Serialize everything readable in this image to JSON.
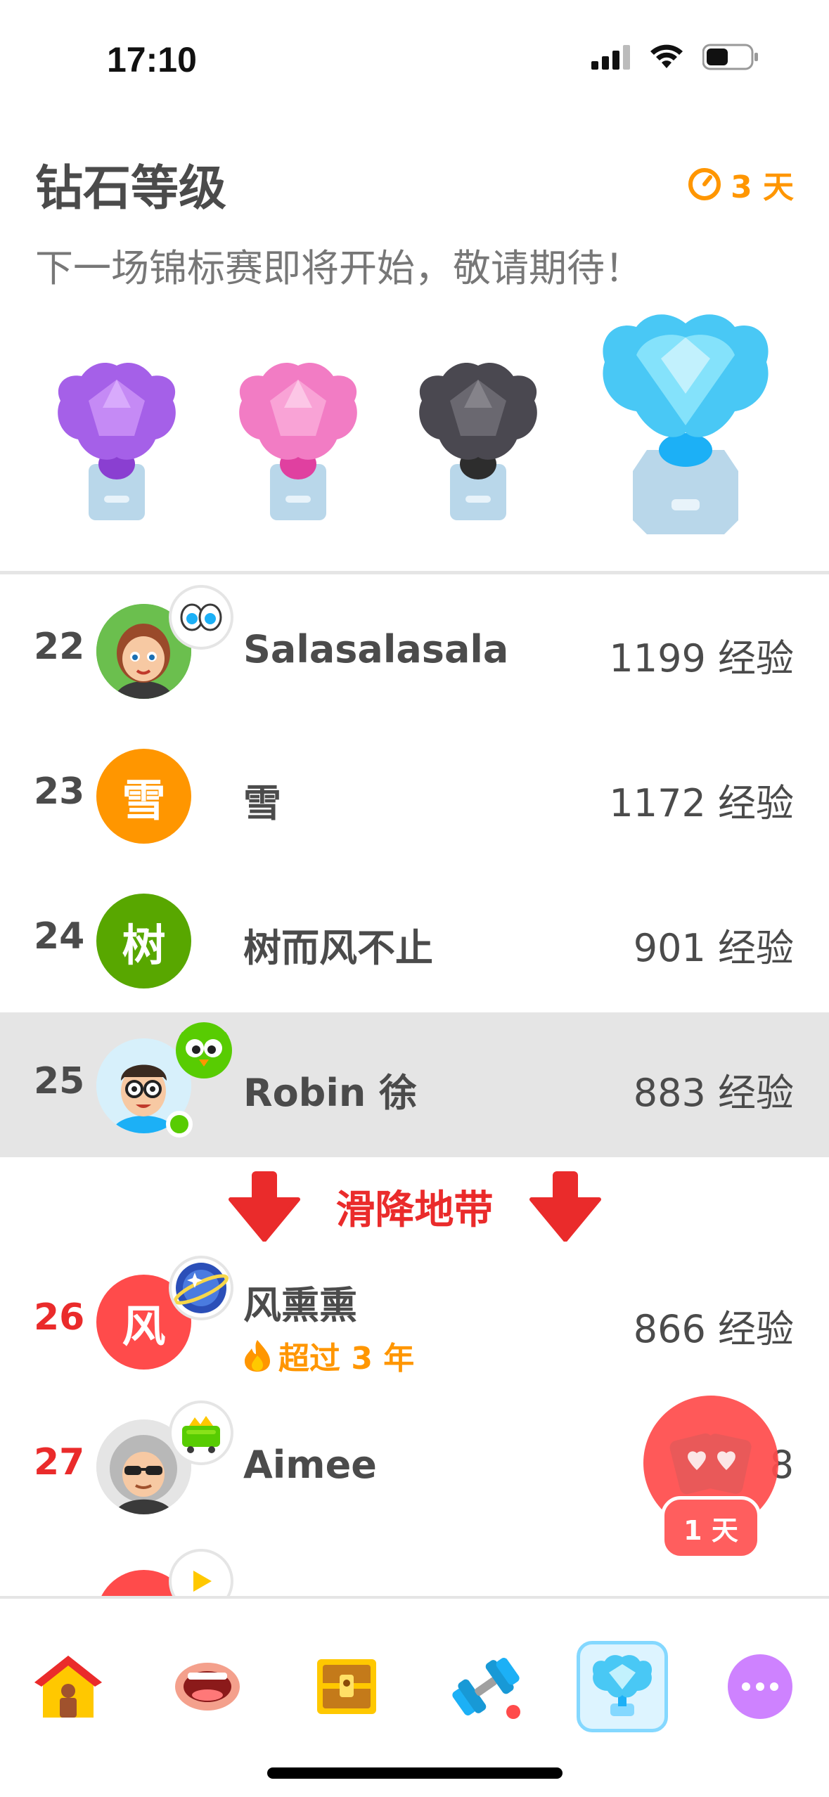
{
  "status": {
    "time": "17:10"
  },
  "header": {
    "title": "钻石等级",
    "timer": "3 天",
    "subtitle": "下一场锦标赛即将开始，敬请期待！"
  },
  "leaderboard": [
    {
      "rank": "22",
      "name": "Salasalasala",
      "xp": "1199 经验",
      "avatar_letter": ""
    },
    {
      "rank": "23",
      "name": "雪",
      "xp": "1172 经验",
      "avatar_letter": "雪"
    },
    {
      "rank": "24",
      "name": "树而风不止",
      "xp": "901 经验",
      "avatar_letter": "树"
    },
    {
      "rank": "25",
      "name": "Robin 徐",
      "xp": "883 经验",
      "avatar_letter": ""
    },
    {
      "rank": "26",
      "name": "风熏熏",
      "xp": "866 经验",
      "avatar_letter": "风",
      "streak": "超过 3 年"
    },
    {
      "rank": "27",
      "name": "Aimee",
      "xp": "8",
      "avatar_letter": ""
    }
  ],
  "demotion_zone": {
    "label": "滑降地带"
  },
  "floating_button": {
    "label": "1 天"
  },
  "colors": {
    "orange": "#ff9600",
    "red": "#ea2b2b",
    "green": "#58cc02",
    "blue": "#1cb0f6"
  },
  "nav_icons": [
    "home-icon",
    "speaking-icon",
    "treasure-chest-icon",
    "practice-dumbbell-icon",
    "leaderboard-trophy-icon",
    "more-icon"
  ]
}
